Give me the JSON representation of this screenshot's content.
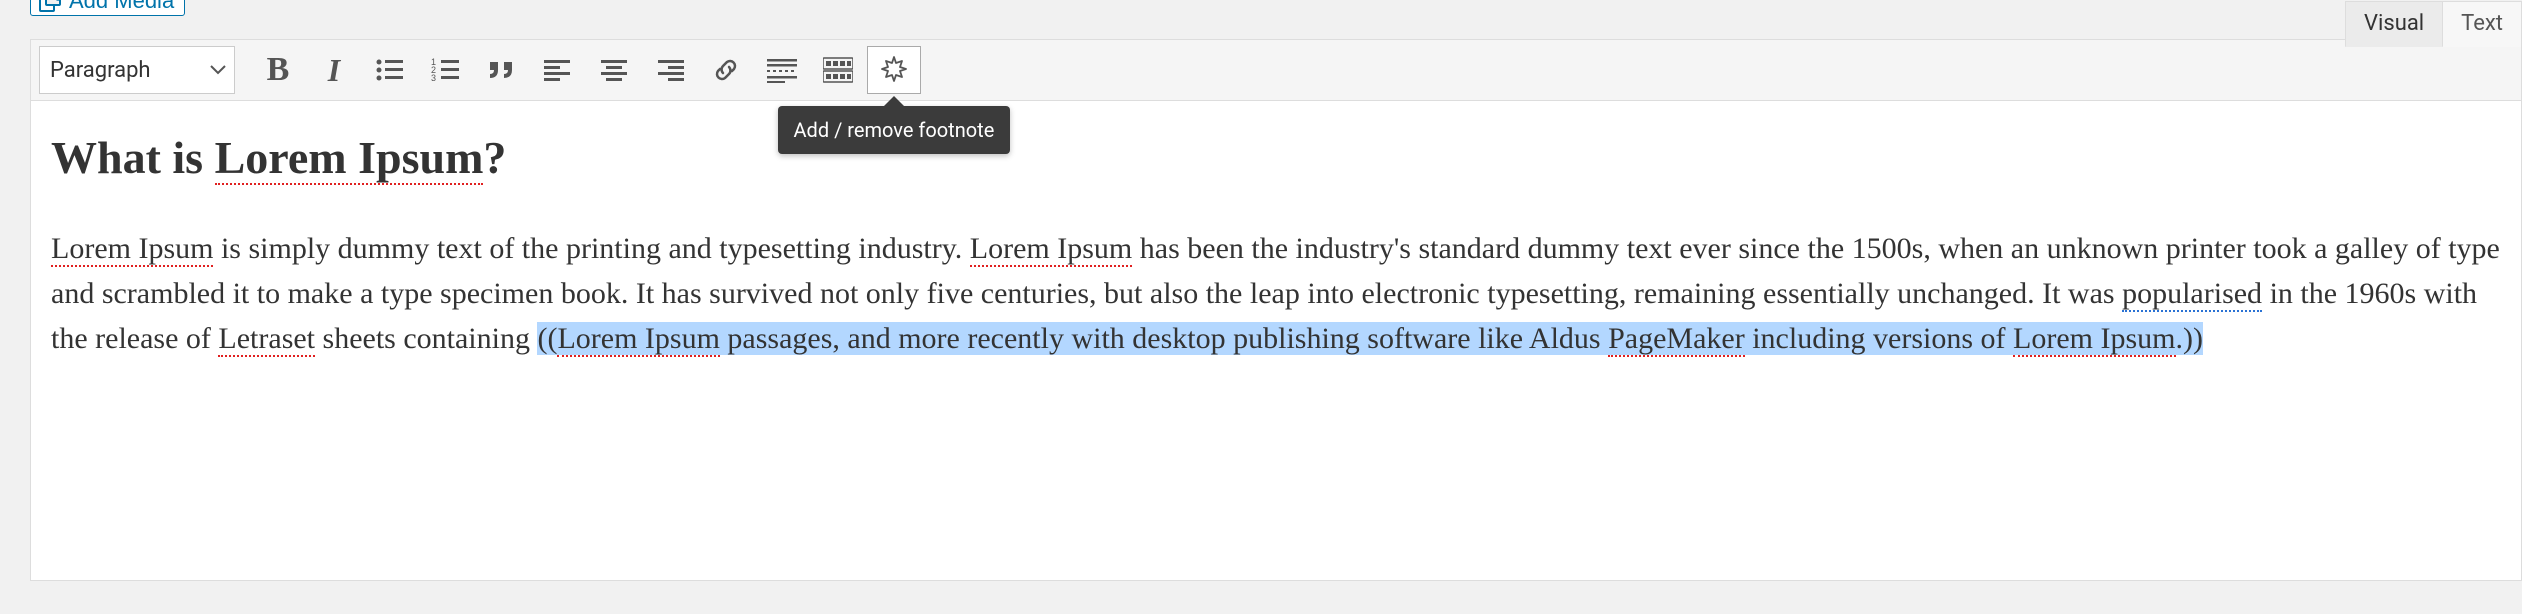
{
  "add_media_label": "Add Media",
  "mode_tabs": {
    "visual": "Visual",
    "text": "Text"
  },
  "format_select": "Paragraph",
  "tooltip_footnote": "Add / remove footnote",
  "content": {
    "heading_prefix": "What is ",
    "heading_term": "Lorem Ipsum",
    "heading_suffix": "?",
    "p_part1_a": "Lorem Ipsum",
    "p_part1_b": " is simply dummy text of the printing and typesetting industry. ",
    "p_part1_c": "Lorem Ipsum",
    "p_part1_d": " has been the industry's standard dummy text ever since the 1500s, when an unknown printer took a galley of type and scrambled it to make a type specimen book. It has survived not only five centuries, but also the leap into electronic typesetting, remaining essentially unchanged. It was ",
    "p_part1_e": "popularised",
    "p_part1_f": " in the 1960s with the release of ",
    "p_part1_g": "Letraset",
    "p_part1_h": " sheets containing ",
    "sel_a": "((",
    "sel_b": "Lorem Ipsum",
    "sel_c": " passages, and more recently with desktop publishing software like Aldus ",
    "sel_d": "PageMaker",
    "sel_e": " including versions of ",
    "sel_f": "Lorem Ipsum",
    "sel_g": ".))"
  }
}
